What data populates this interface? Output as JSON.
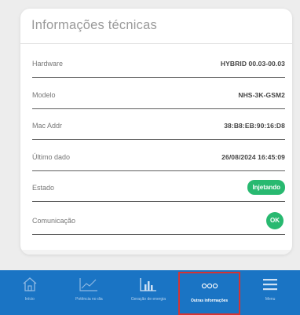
{
  "card": {
    "title": "Informações técnicas",
    "rows": [
      {
        "label": "Hardware",
        "value": "HYBRID 00.03-00.03"
      },
      {
        "label": "Modelo",
        "value": "NHS-3K-GSM2"
      },
      {
        "label": "Mac Addr",
        "value": "38:B8:EB:90:16:D8"
      },
      {
        "label": "Último dado",
        "value": "26/08/2024 16:45:09"
      },
      {
        "label": "Estado",
        "value": "Injetando"
      },
      {
        "label": "Comunicação",
        "value": "OK"
      }
    ]
  },
  "nav": {
    "items": [
      {
        "label": "Início",
        "icon": "home-icon"
      },
      {
        "label": "Potência no dia",
        "icon": "line-chart-icon"
      },
      {
        "label": "Geração de energia",
        "icon": "bar-chart-icon"
      },
      {
        "label": "Outras informações",
        "icon": "more-dots-icon",
        "active": true
      },
      {
        "label": "Menu",
        "icon": "hamburger-icon"
      }
    ]
  },
  "colors": {
    "nav_background": "#1a74c4",
    "status_green": "#28b970",
    "active_highlight": "#d53333"
  }
}
